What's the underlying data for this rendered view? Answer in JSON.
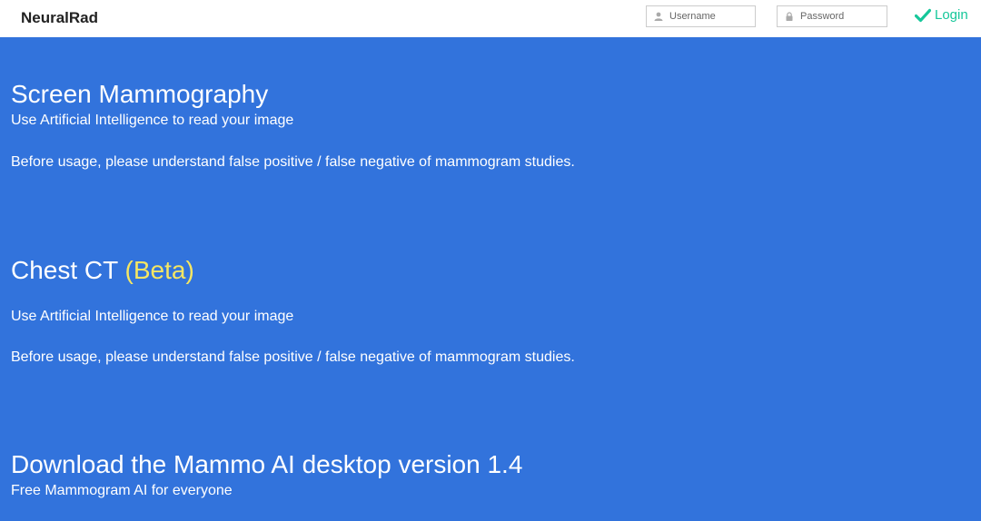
{
  "navbar": {
    "brand": "NeuralRad",
    "username_placeholder": "Username",
    "password_placeholder": "Password",
    "login_label": "Login",
    "login_color": "#16c79a"
  },
  "sections": [
    {
      "title": "Screen Mammography",
      "subtitle": "Use Artificial Intelligence to read your image",
      "note": "Before usage, please understand false positive / false negative of mammogram studies."
    },
    {
      "title": "Chest CT",
      "badge": "(Beta)",
      "subtitle": "Use Artificial Intelligence to read your image",
      "note": "Before usage, please understand false positive / false negative of mammogram studies."
    },
    {
      "title": "Download the Mammo AI desktop version 1.4",
      "subtitle": "Free Mammogram AI for everyone"
    }
  ],
  "colors": {
    "hero_background": "#3273dc",
    "beta_badge": "#f5e663"
  },
  "icons": {
    "username": "user-icon",
    "password": "lock-icon",
    "login": "checkmark-icon"
  }
}
